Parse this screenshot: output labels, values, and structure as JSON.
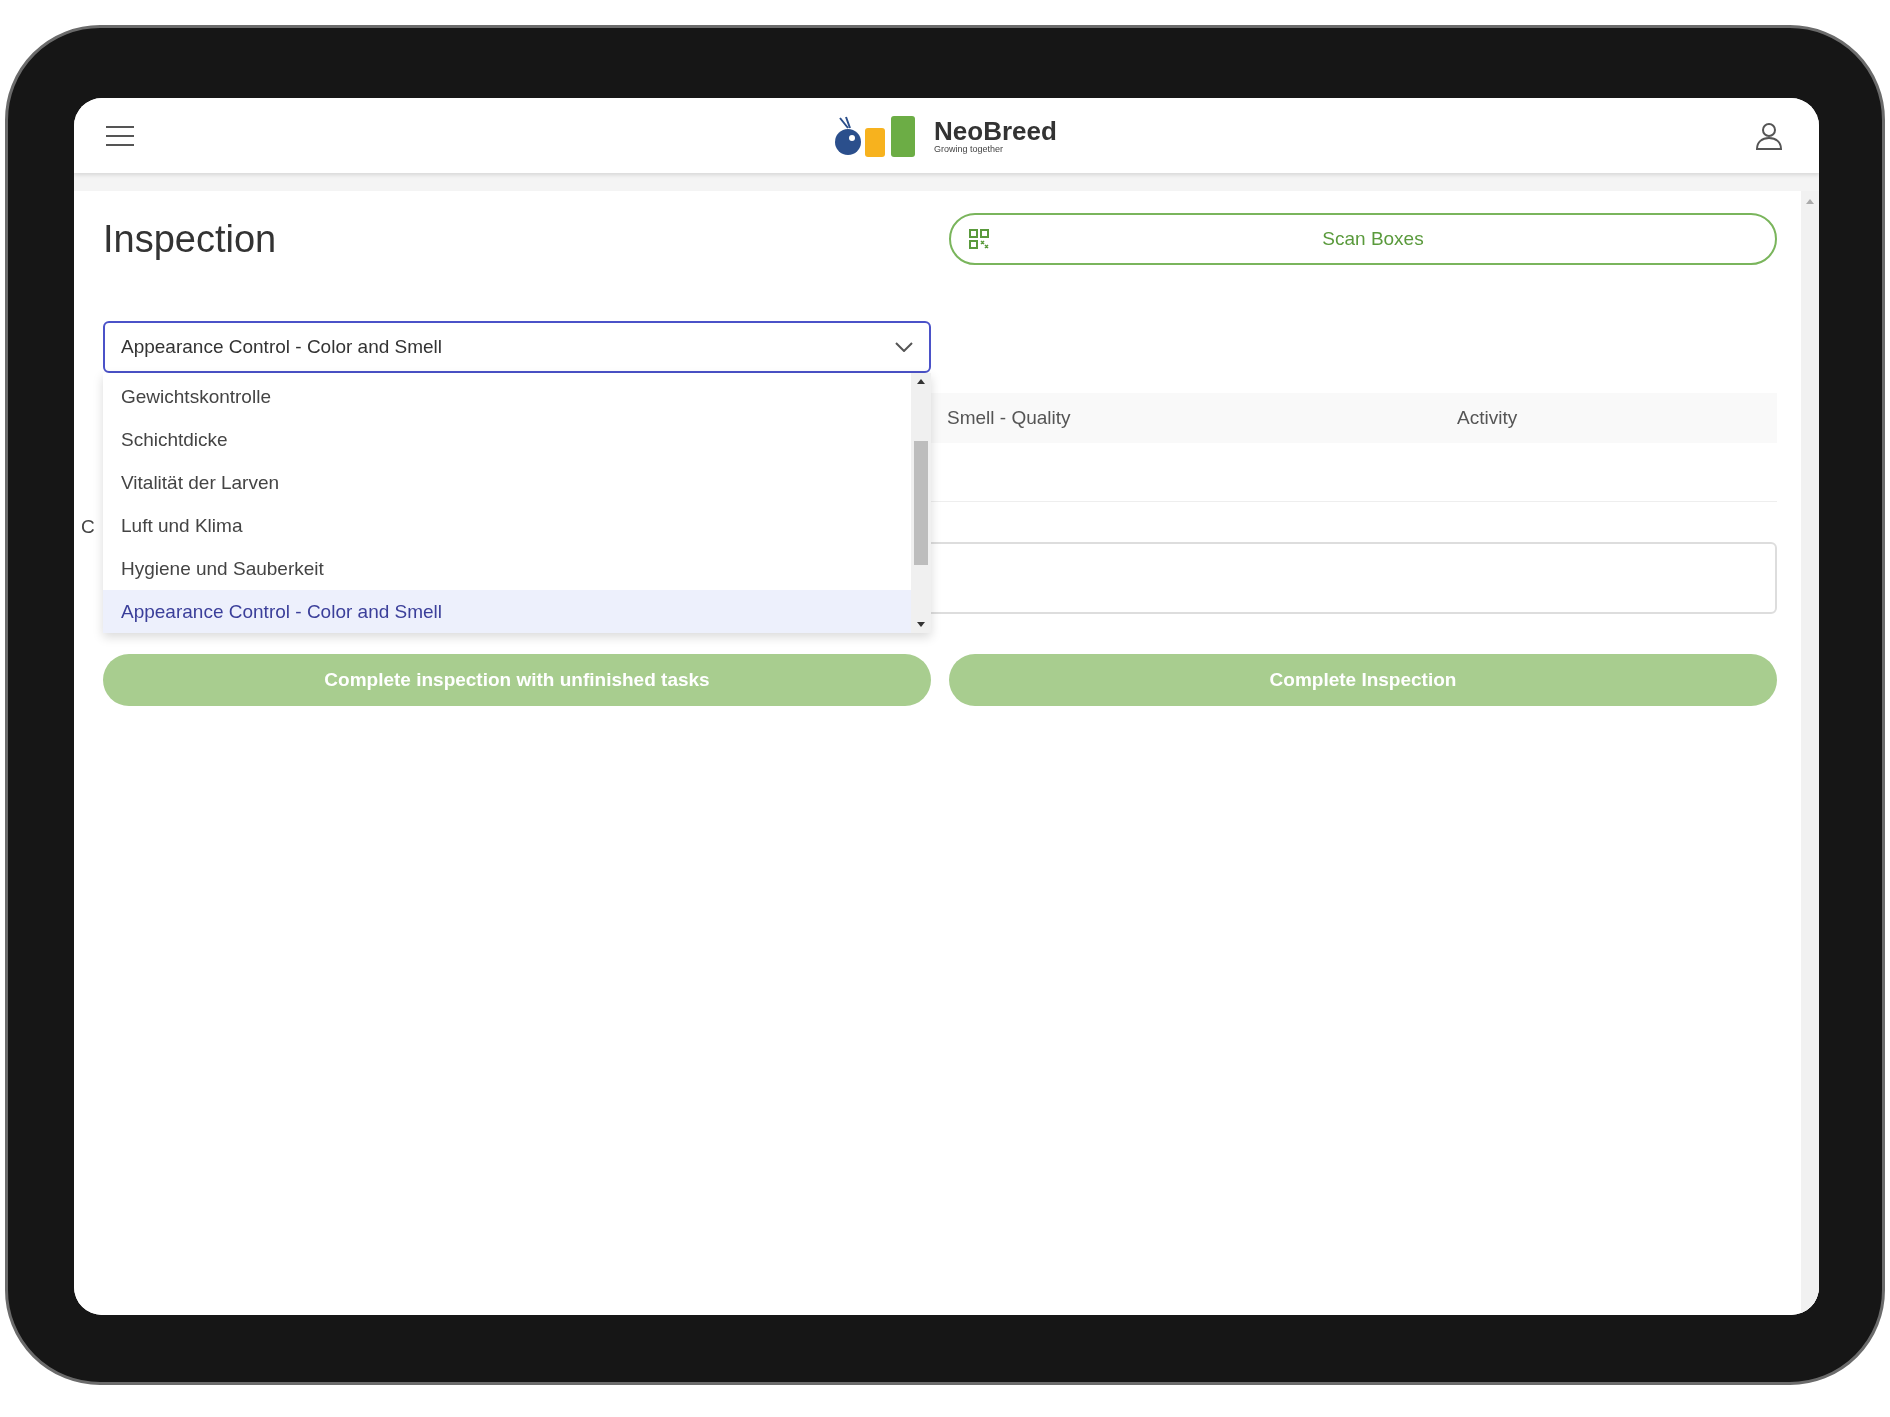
{
  "header": {
    "brand": "NeoBreed",
    "tagline": "Growing together"
  },
  "page_title": "Inspection",
  "scan_button": "Scan Boxes",
  "select": {
    "value": "Appearance Control - Color and Smell",
    "expanded": true,
    "options": [
      {
        "label": "Gewichtskontrolle",
        "selected": false
      },
      {
        "label": "Schichtdicke",
        "selected": false
      },
      {
        "label": "Vitalität der Larven",
        "selected": false
      },
      {
        "label": "Luft und Klima",
        "selected": false
      },
      {
        "label": "Hygiene und Sauberkeit",
        "selected": false
      },
      {
        "label": "Appearance Control - Color and Smell",
        "selected": true
      }
    ]
  },
  "table": {
    "columns": [
      "Smell - Quality",
      "Activity"
    ]
  },
  "field_label": "C",
  "actions": [
    "Complete inspection with unfinished tasks",
    "Complete Inspection"
  ]
}
